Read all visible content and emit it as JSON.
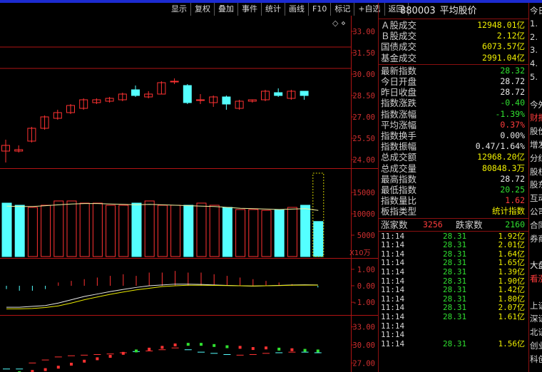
{
  "toolbar": [
    "显示",
    "复权",
    "叠加",
    "事件",
    "统计",
    "画线",
    "F10",
    "标记",
    "+自选",
    "返回"
  ],
  "header": {
    "code": "880003",
    "name": "平均股价"
  },
  "summary": [
    {
      "label": "Ａ股成交",
      "value": "12948.01亿",
      "color": "#f0f000"
    },
    {
      "label": "Ｂ股成交",
      "value": "2.12亿",
      "color": "#f0f000"
    },
    {
      "label": "国债成交",
      "value": "6073.57亿",
      "color": "#f0f000"
    },
    {
      "label": "基金成交",
      "value": "2991.04亿",
      "color": "#f0f000"
    }
  ],
  "index_stats": [
    {
      "label": "最新指数",
      "value": "28.32",
      "color": "#30e030"
    },
    {
      "label": "今日开盘",
      "value": "28.72",
      "color": "#e8e8e8"
    },
    {
      "label": "昨日收盘",
      "value": "28.72",
      "color": "#e8e8e8"
    },
    {
      "label": "指数涨跌",
      "value": "-0.40",
      "color": "#30e030"
    },
    {
      "label": "指数涨幅",
      "value": "-1.39%",
      "color": "#30e030"
    },
    {
      "label": "平均涨幅",
      "value": "0.37%",
      "color": "#ff3c3c"
    },
    {
      "label": "指数换手",
      "value": "0.00%",
      "color": "#e8e8e8"
    },
    {
      "label": "指数振幅",
      "value": "0.47/1.64%",
      "color": "#e8e8e8"
    },
    {
      "label": "总成交额",
      "value": "12968.20亿",
      "color": "#f0f000"
    },
    {
      "label": "总成交量",
      "value": "80848.3万",
      "color": "#f0f000"
    },
    {
      "label": "最高指数",
      "value": "28.72",
      "color": "#e8e8e8"
    },
    {
      "label": "最低指数",
      "value": "20.25",
      "color": "#30e030"
    },
    {
      "label": "指数量比",
      "value": "1.62",
      "color": "#ff3c3c"
    },
    {
      "label": "板指类型",
      "value": "统计指数",
      "color": "#f0f000"
    }
  ],
  "breadth": {
    "up_label": "涨家数",
    "up": "3256",
    "down_label": "跌家数",
    "down": "2160"
  },
  "ticks": [
    {
      "time": "11:14",
      "price": "28.31",
      "vol": "1.92亿"
    },
    {
      "time": "11:14",
      "price": "28.31",
      "vol": "2.01亿"
    },
    {
      "time": "11:14",
      "price": "28.31",
      "vol": "1.64亿"
    },
    {
      "time": "11:14",
      "price": "28.31",
      "vol": "1.65亿"
    },
    {
      "time": "11:14",
      "price": "28.31",
      "vol": "1.39亿"
    },
    {
      "time": "11:14",
      "price": "28.31",
      "vol": "1.90亿"
    },
    {
      "time": "11:14",
      "price": "28.31",
      "vol": "1.42亿"
    },
    {
      "time": "11:14",
      "price": "28.31",
      "vol": "1.80亿"
    },
    {
      "time": "11:14",
      "price": "28.31",
      "vol": "2.07亿"
    },
    {
      "time": "11:14",
      "price": "28.31",
      "vol": "1.61亿"
    },
    {
      "time": "11:14",
      "price": "",
      "vol": ""
    },
    {
      "time": "11:14",
      "price": "",
      "vol": ""
    },
    {
      "time": "11:14",
      "price": "28.31",
      "vol": "1.56亿"
    }
  ],
  "side_items": [
    {
      "text": "今日",
      "color": "#d8d8d8"
    },
    {
      "text": "1.",
      "color": "#d8d8d8"
    },
    {
      "text": "2.",
      "color": "#d8d8d8"
    },
    {
      "text": "3.",
      "color": "#d8d8d8"
    },
    {
      "text": "4.",
      "color": "#d8d8d8"
    },
    {
      "text": "5.",
      "color": "#d8d8d8"
    },
    {
      "text": "",
      "color": "#d8d8d8"
    },
    {
      "text": "今外",
      "color": "#d8d8d8"
    },
    {
      "text": "财报",
      "color": "#ff3c3c"
    },
    {
      "text": "股份",
      "color": "#d8d8d8"
    },
    {
      "text": "增发",
      "color": "#d8d8d8"
    },
    {
      "text": "分红",
      "color": "#d8d8d8"
    },
    {
      "text": "股权",
      "color": "#d8d8d8"
    },
    {
      "text": "股东",
      "color": "#d8d8d8"
    },
    {
      "text": "互动",
      "color": "#d8d8d8"
    },
    {
      "text": "公司",
      "color": "#d8d8d8"
    },
    {
      "text": "合同",
      "color": "#d8d8d8"
    },
    {
      "text": "券商",
      "color": "#d8d8d8"
    },
    {
      "text": "",
      "color": "#d8d8d8"
    },
    {
      "text": "大盘",
      "color": "#f0f0f0"
    },
    {
      "text": "看涨",
      "color": "#ff3c3c"
    },
    {
      "text": "",
      "color": "#d8d8d8"
    },
    {
      "text": "上证",
      "color": "#d8d8d8"
    },
    {
      "text": "深证",
      "color": "#d8d8d8"
    },
    {
      "text": "北证",
      "color": "#d8d8d8"
    },
    {
      "text": "创业",
      "color": "#d8d8d8"
    },
    {
      "text": "科创",
      "color": "#d8d8d8"
    }
  ],
  "chart_data": [
    {
      "type": "candlestick",
      "y_ticks": [
        "33.00",
        "31.50",
        "30.00",
        "28.50",
        "27.00",
        "25.50",
        "24.00"
      ],
      "ylim": [
        23.5,
        34.0
      ],
      "candles": [
        {
          "o": 24.6,
          "c": 25.0,
          "h": 25.4,
          "l": 23.8
        },
        {
          "o": 24.6,
          "c": 24.7,
          "h": 25.0,
          "l": 24.5
        },
        {
          "o": 25.3,
          "c": 26.2,
          "h": 26.3,
          "l": 25.2
        },
        {
          "o": 26.2,
          "c": 27.0,
          "h": 27.1,
          "l": 26.1
        },
        {
          "o": 26.9,
          "c": 27.3,
          "h": 27.5,
          "l": 26.8
        },
        {
          "o": 27.3,
          "c": 27.8,
          "h": 27.9,
          "l": 27.2
        },
        {
          "o": 27.6,
          "c": 28.2,
          "h": 28.3,
          "l": 27.5
        },
        {
          "o": 28.0,
          "c": 28.2,
          "h": 28.3,
          "l": 27.9
        },
        {
          "o": 28.1,
          "c": 28.3,
          "h": 28.4,
          "l": 28.0
        },
        {
          "o": 28.2,
          "c": 28.6,
          "h": 28.7,
          "l": 28.1
        },
        {
          "o": 28.9,
          "c": 28.5,
          "h": 29.2,
          "l": 28.4
        },
        {
          "o": 28.4,
          "c": 28.6,
          "h": 28.8,
          "l": 28.3
        },
        {
          "o": 28.6,
          "c": 29.4,
          "h": 29.5,
          "l": 28.6
        },
        {
          "o": 29.5,
          "c": 29.5,
          "h": 29.7,
          "l": 29.3
        },
        {
          "o": 29.2,
          "c": 28.0,
          "h": 29.3,
          "l": 27.9
        },
        {
          "o": 28.2,
          "c": 28.2,
          "h": 28.6,
          "l": 27.9
        },
        {
          "o": 28.0,
          "c": 28.4,
          "h": 28.5,
          "l": 27.7
        },
        {
          "o": 28.4,
          "c": 27.9,
          "h": 28.5,
          "l": 27.5
        },
        {
          "o": 27.6,
          "c": 28.1,
          "h": 28.2,
          "l": 27.5
        },
        {
          "o": 28.1,
          "c": 28.2,
          "h": 28.2,
          "l": 28.0
        },
        {
          "o": 28.2,
          "c": 28.8,
          "h": 28.9,
          "l": 28.1
        },
        {
          "o": 28.7,
          "c": 28.5,
          "h": 29.0,
          "l": 28.4
        },
        {
          "o": 28.3,
          "c": 28.8,
          "h": 28.9,
          "l": 28.2
        },
        {
          "o": 28.8,
          "c": 28.5,
          "h": 28.8,
          "l": 28.2
        }
      ]
    },
    {
      "type": "bar",
      "y_ticks": [
        "15000",
        "10000",
        "5000"
      ],
      "unit": "X10万",
      "ylim": [
        0,
        20000
      ],
      "values": [
        12500,
        12000,
        11500,
        12000,
        13000,
        13000,
        12500,
        12500,
        12000,
        12000,
        12500,
        13000,
        12000,
        12000,
        12000,
        12500,
        12000,
        11500,
        11000,
        11000,
        10800,
        11000,
        11500,
        12000,
        8200
      ],
      "ma": [
        11800,
        11700,
        11700,
        11900,
        12100,
        12300,
        12400,
        12400,
        12300,
        12200,
        12100,
        12200,
        12100,
        12000,
        11900,
        11800,
        11700,
        11500,
        11300,
        11200,
        11100,
        11000,
        11100,
        11200,
        10800
      ],
      "up": [
        0,
        0,
        1,
        1,
        1,
        1,
        1,
        1,
        1,
        1,
        0,
        1,
        1,
        1,
        0,
        1,
        1,
        0,
        1,
        1,
        1,
        0,
        1,
        0,
        0
      ],
      "highlight_last": 1
    },
    {
      "type": "line",
      "y_ticks": [
        "1.00",
        "0.00",
        "-1.00"
      ],
      "ylim": [
        -1.6,
        1.6
      ],
      "macd": [
        -0.2,
        -0.3,
        -0.3,
        -0.2,
        0.2,
        0.3,
        0.4,
        0.5,
        0.6,
        0.7,
        0.6,
        0.8,
        0.8,
        0.9,
        0.8,
        0.8,
        0.7,
        0.6,
        0.5,
        0.4,
        0.3,
        0.2,
        0.1,
        0.0,
        -0.1
      ],
      "dif": [
        -1.3,
        -1.3,
        -1.25,
        -1.2,
        -1.05,
        -0.85,
        -0.65,
        -0.5,
        -0.35,
        -0.22,
        -0.1,
        0.0,
        0.05,
        0.1,
        0.1,
        0.08,
        0.05,
        0.02,
        0.0,
        -0.02,
        0.0,
        0.02,
        0.05,
        0.06,
        0.05
      ],
      "dea": [
        -1.4,
        -1.4,
        -1.38,
        -1.32,
        -1.22,
        -1.05,
        -0.85,
        -0.68,
        -0.52,
        -0.38,
        -0.25,
        -0.15,
        -0.05,
        0.0,
        0.03,
        0.03,
        0.02,
        0.01,
        0.0,
        -0.01,
        0.0,
        0.01,
        0.03,
        0.04,
        0.04
      ]
    },
    {
      "type": "scatter",
      "y_ticks": [
        "33.00",
        "30.00",
        "27.00"
      ],
      "ylim": [
        25.5,
        34.5
      ],
      "sar": [
        25.2,
        25.4,
        25.6,
        25.9,
        26.3,
        26.8,
        27.3,
        27.7,
        28.1,
        28.6,
        29.0,
        29.3,
        29.6,
        30.0,
        30.1,
        30.1,
        29.9,
        29.7,
        29.6,
        29.4,
        29.5,
        29.3,
        29.2,
        29.1,
        29.0
      ],
      "line": [
        26.0,
        26.0,
        27.0,
        27.5,
        28.0,
        28.2,
        28.3,
        28.4,
        28.5,
        28.7,
        28.9,
        29.0,
        29.2,
        29.5,
        29.2,
        28.8,
        28.6,
        28.4,
        28.3,
        28.4,
        28.6,
        28.7,
        28.8,
        28.8,
        28.7
      ],
      "up": [
        0,
        0,
        1,
        1,
        1,
        1,
        1,
        1,
        1,
        1,
        0,
        1,
        1,
        1,
        0,
        0,
        0,
        0,
        1,
        1,
        1,
        0,
        1,
        0,
        0
      ]
    }
  ]
}
